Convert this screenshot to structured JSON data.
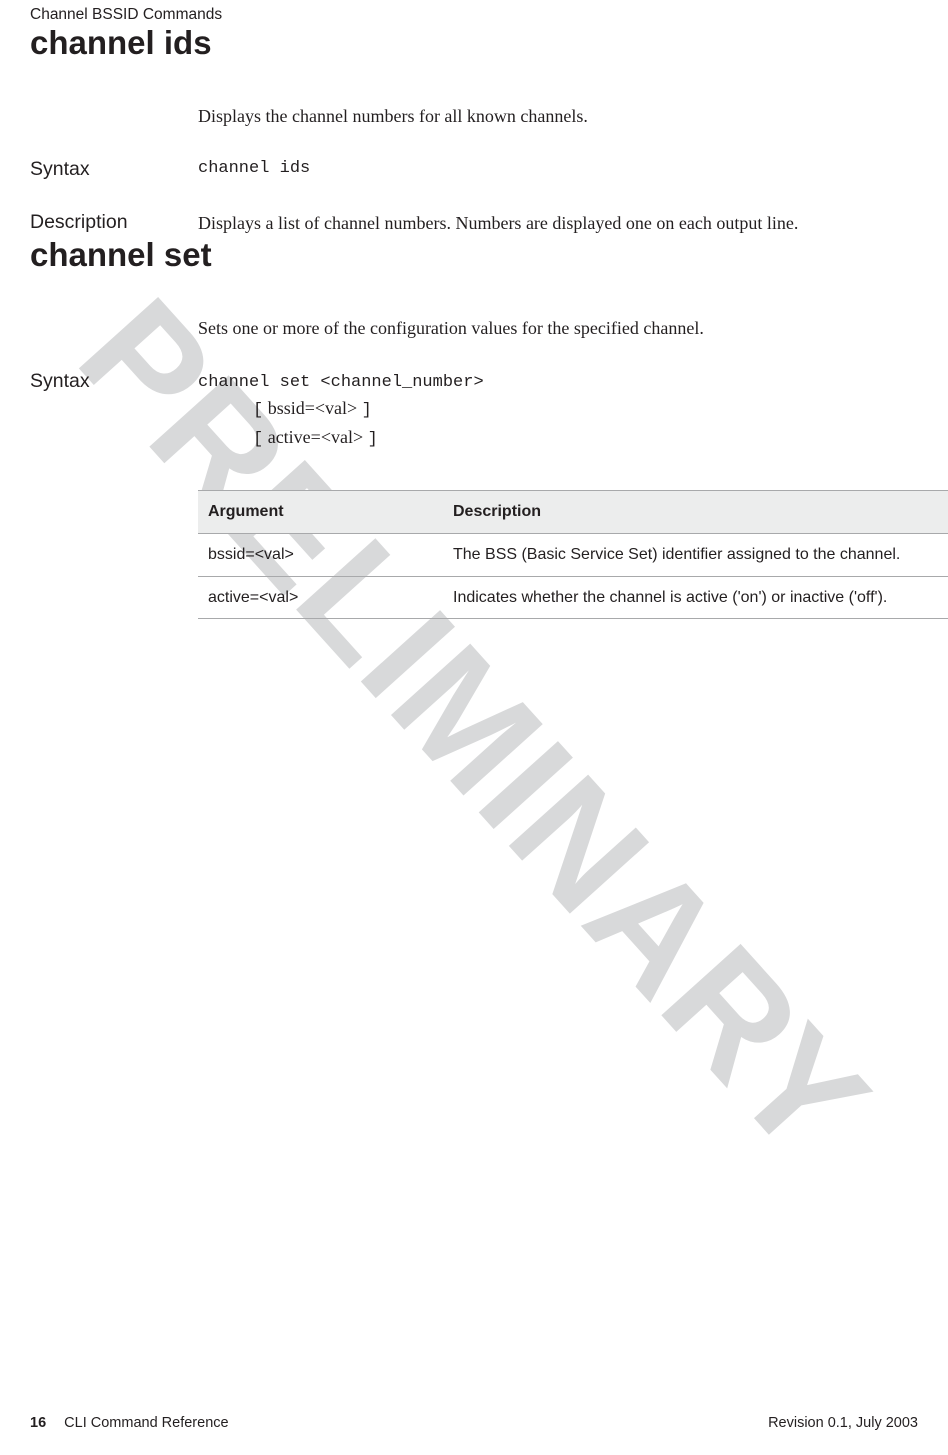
{
  "header": {
    "running_title": "Channel BSSID Commands"
  },
  "watermark": "PRELIMINARY",
  "sections": {
    "channel_ids": {
      "title": "channel ids",
      "intro": "Displays the channel numbers for all known channels.",
      "syntax_label": "Syntax",
      "syntax_code": "channel ids",
      "description_label": "Description",
      "description_text": "Displays a list of channel numbers. Numbers are displayed one on each output line."
    },
    "channel_set": {
      "title": "channel set",
      "intro": "Sets one or more of the configuration values for the specified channel.",
      "syntax_label": "Syntax",
      "syntax_line1": "channel set <channel_number>",
      "syntax_opt1_bracket_open": "[",
      "syntax_opt1_text": " bssid=<val> ",
      "syntax_opt1_bracket_close": "]",
      "syntax_opt2_bracket_open": "[",
      "syntax_opt2_text": " active=<val> ",
      "syntax_opt2_bracket_close": "]",
      "table": {
        "col1": "Argument",
        "col2": "Description",
        "rows": [
          {
            "arg": "bssid=<val>",
            "desc": "The BSS (Basic Service Set) identifier assigned to the channel."
          },
          {
            "arg": "active=<val>",
            "desc": "Indicates whether the channel is active ('on') or inactive ('off')."
          }
        ]
      }
    }
  },
  "footer": {
    "page_number": "16",
    "doc_title": "CLI Command Reference",
    "revision": "Revision 0.1, July 2003"
  }
}
